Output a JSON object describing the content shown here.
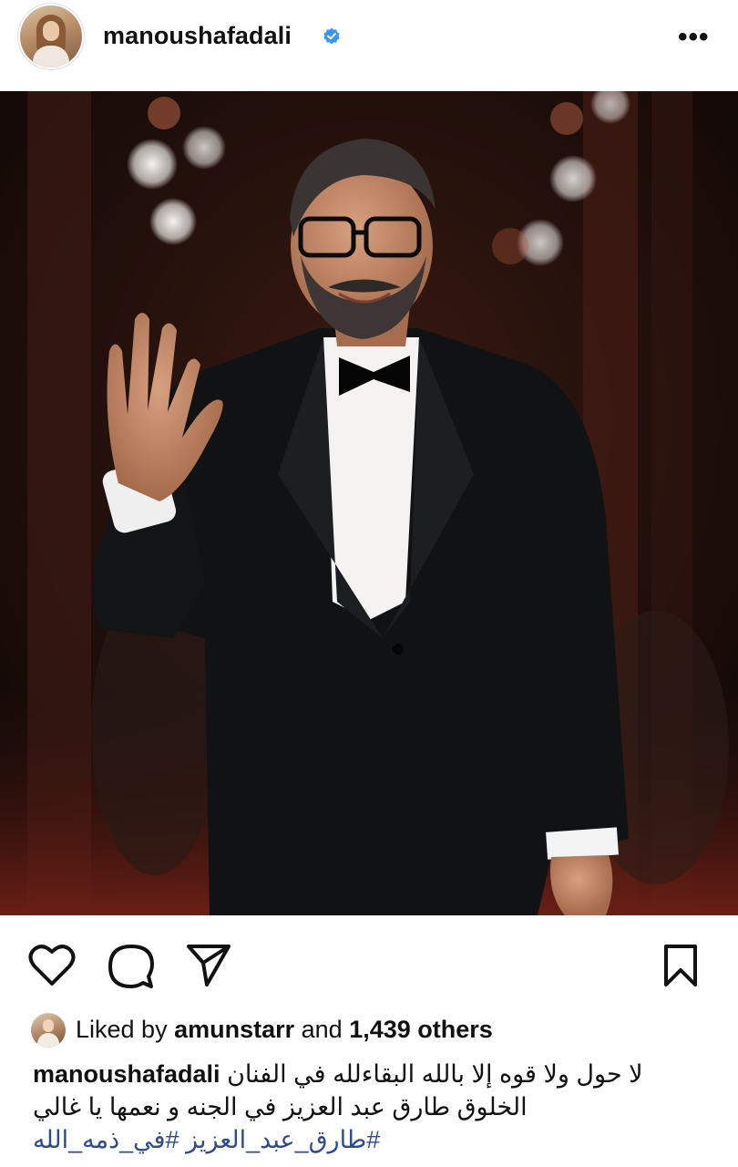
{
  "post": {
    "username": "manoushafadali",
    "verified": true,
    "more_label": "•••"
  },
  "icons": {
    "like": "heart-icon",
    "comment": "comment-icon",
    "share": "paper-plane-icon",
    "save": "bookmark-icon",
    "verified": "verified-badge-icon",
    "more": "more-options-icon"
  },
  "likes": {
    "prefix": "Liked by ",
    "user": "amunstarr",
    "middle": " and ",
    "count": "1,439 others"
  },
  "caption": {
    "username": "manoushafadali",
    "line1": "لا حول ولا قوه إلا بالله البقاءلله في الفنان",
    "line2": "الخلوق طارق  عبد العزيز في الجنه و نعمها يا غالي",
    "hashtags": "#طارق_عبد_العزيز #في_ذمه_الله"
  },
  "colors": {
    "verified": "#3897f0",
    "hashtag": "#2f4b8a",
    "text": "#111111"
  }
}
